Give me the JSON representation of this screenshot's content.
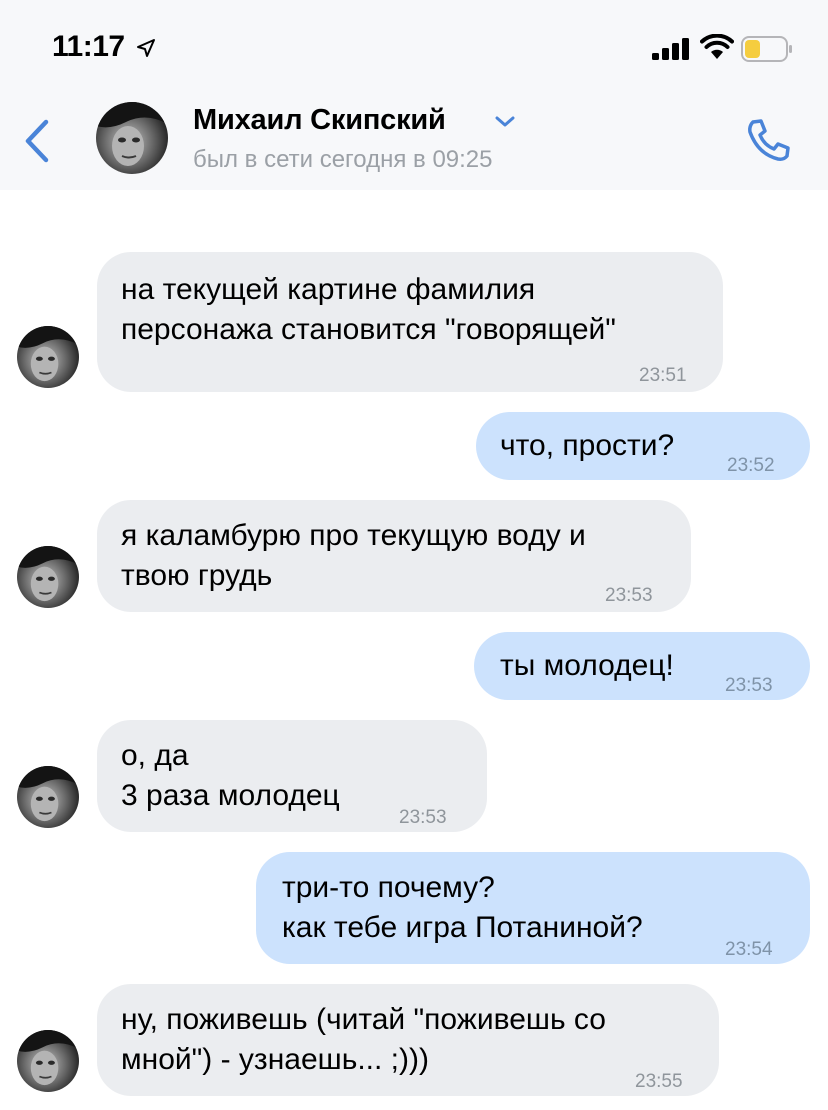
{
  "status_bar": {
    "time": "11:17",
    "icons": [
      "location-arrow-icon",
      "signal-icon",
      "wifi-icon",
      "battery-icon"
    ],
    "battery_color": "#f5cd3f"
  },
  "header": {
    "contact_name": "Михаил Скипский",
    "last_seen": "был в сети сегодня в 09:25",
    "accent_color": "#4a84d8"
  },
  "messages": [
    {
      "direction": "incoming",
      "text": "на текущей картине фамилия\nперсонажа становится \"говорящей\"",
      "time": "23:51"
    },
    {
      "direction": "outgoing",
      "text": "что, прости?",
      "time": "23:52"
    },
    {
      "direction": "incoming",
      "text": "я каламбурю про текущую воду и\nтвою грудь",
      "time": "23:53"
    },
    {
      "direction": "outgoing",
      "text": "ты молодец!",
      "time": "23:53"
    },
    {
      "direction": "incoming",
      "text": "о, да\n3 раза молодец",
      "time": "23:53"
    },
    {
      "direction": "outgoing",
      "text": "три-то почему?\nкак тебе игра Потаниной?",
      "time": "23:54"
    },
    {
      "direction": "incoming",
      "text": "ну, поживешь (читай \"поживешь со\nмной\") - узнаешь... ;)))",
      "time": "23:55"
    }
  ]
}
